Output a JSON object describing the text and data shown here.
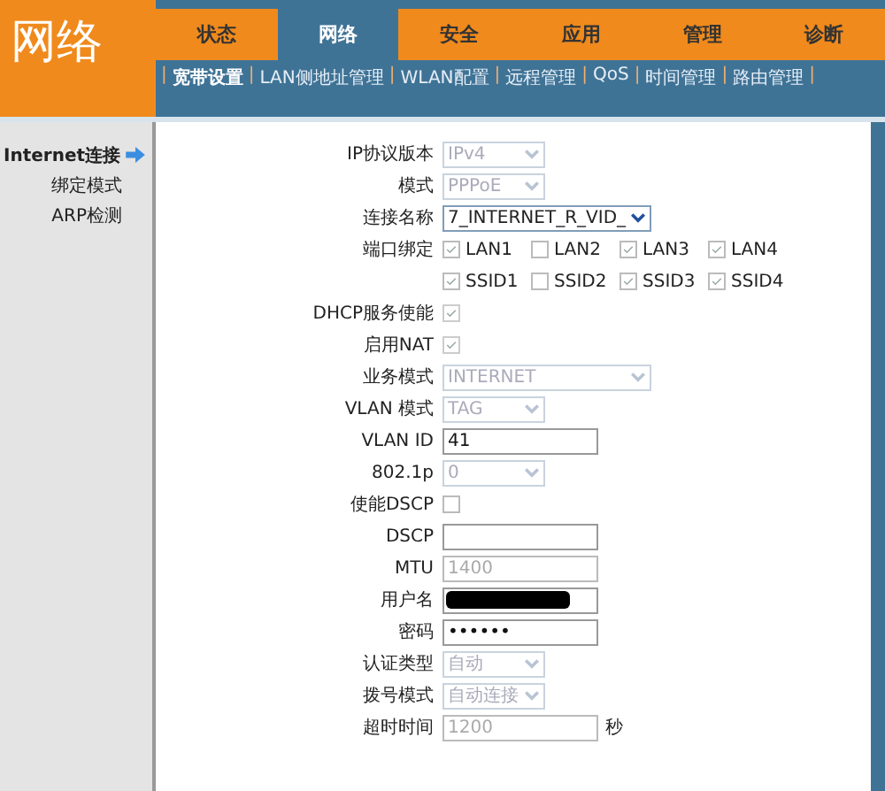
{
  "header": {
    "title": "网络"
  },
  "tabs": [
    {
      "label": "状态",
      "selected": false
    },
    {
      "label": "网络",
      "selected": true
    },
    {
      "label": "安全",
      "selected": false
    },
    {
      "label": "应用",
      "selected": false
    },
    {
      "label": "管理",
      "selected": false
    },
    {
      "label": "诊断",
      "selected": false
    }
  ],
  "subnav": {
    "separator": "|",
    "items": [
      {
        "label": "宽带设置",
        "selected": true
      },
      {
        "label": "LAN侧地址管理",
        "selected": false
      },
      {
        "label": "WLAN配置",
        "selected": false
      },
      {
        "label": "远程管理",
        "selected": false
      },
      {
        "label": "QoS",
        "selected": false
      },
      {
        "label": "时间管理",
        "selected": false
      },
      {
        "label": "路由管理",
        "selected": false
      }
    ]
  },
  "sidebar": {
    "items": [
      {
        "label": "Internet连接",
        "selected": true
      },
      {
        "label": "绑定模式",
        "selected": false
      },
      {
        "label": "ARP检测",
        "selected": false
      }
    ]
  },
  "form": {
    "rows": [
      {
        "label": "IP协议版本",
        "kind": "select",
        "value": "IPv4",
        "disabled": true
      },
      {
        "label": "模式",
        "kind": "select",
        "value": "PPPoE",
        "disabled": true
      },
      {
        "label": "连接名称",
        "kind": "select",
        "value": "7_INTERNET_R_VID_",
        "disabled": false
      },
      {
        "label": "端口绑定",
        "kind": "checkgroup",
        "options": [
          {
            "label": "LAN1",
            "checked": true
          },
          {
            "label": "LAN2",
            "checked": false
          },
          {
            "label": "LAN3",
            "checked": true
          },
          {
            "label": "LAN4",
            "checked": true
          }
        ]
      },
      {
        "label": "",
        "kind": "checkgroup",
        "options": [
          {
            "label": "SSID1",
            "checked": true
          },
          {
            "label": "SSID2",
            "checked": false
          },
          {
            "label": "SSID3",
            "checked": true
          },
          {
            "label": "SSID4",
            "checked": true
          }
        ]
      },
      {
        "label": "DHCP服务使能",
        "kind": "checkbox",
        "checked": true,
        "disabled": true
      },
      {
        "label": "启用NAT",
        "kind": "checkbox",
        "checked": true,
        "disabled": true
      },
      {
        "label": "业务模式",
        "kind": "select",
        "value": "INTERNET",
        "disabled": true
      },
      {
        "label": "VLAN 模式",
        "kind": "select",
        "value": "TAG",
        "disabled": true
      },
      {
        "label": "VLAN ID",
        "kind": "input",
        "value": "41",
        "disabled": false
      },
      {
        "label": "802.1p",
        "kind": "select",
        "value": "0",
        "disabled": true
      },
      {
        "label": "使能DSCP",
        "kind": "checkbox",
        "checked": false,
        "disabled": false
      },
      {
        "label": "DSCP",
        "kind": "input",
        "disabled": false
      },
      {
        "label": "MTU",
        "kind": "input",
        "value": "1400",
        "disabled": true
      },
      {
        "label": "用户名",
        "kind": "redacted"
      },
      {
        "label": "密码",
        "kind": "password",
        "value": "••••••",
        "disabled": false
      },
      {
        "label": "认证类型",
        "kind": "select",
        "value": "自动",
        "disabled": true
      },
      {
        "label": "拨号模式",
        "kind": "select",
        "value": "自动连接",
        "disabled": true
      },
      {
        "label": "超时时间",
        "kind": "input",
        "value": "1200",
        "disabled": true,
        "unit": "秒"
      }
    ]
  }
}
